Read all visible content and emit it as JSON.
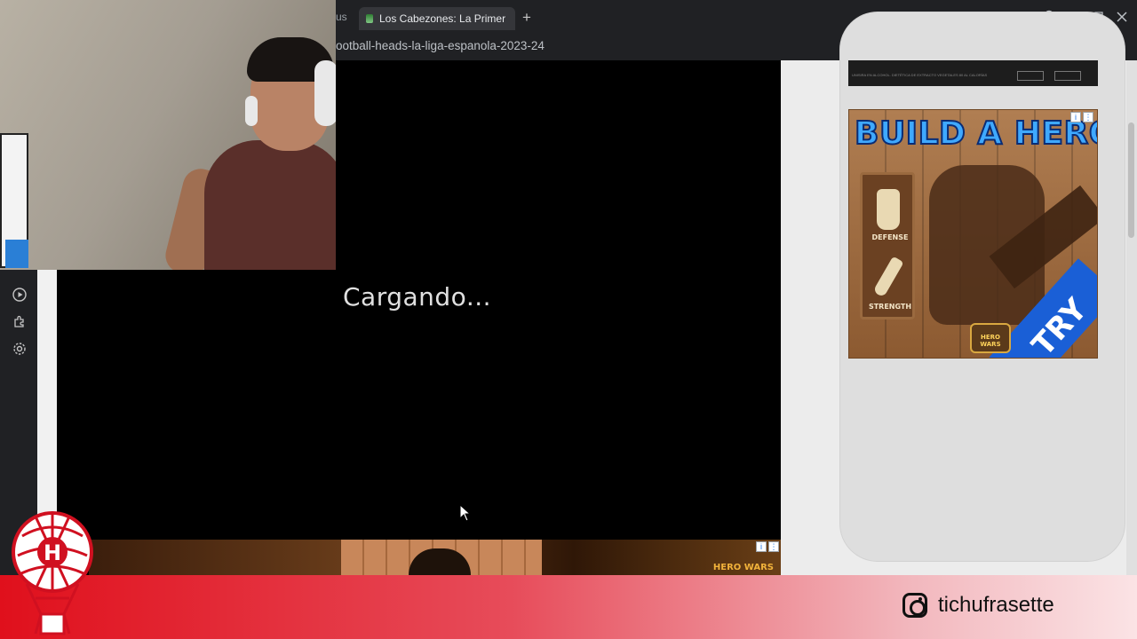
{
  "browser": {
    "prev_tab_fragment": "us",
    "active_tab_title": "Los Cabezones: La Primer",
    "new_tab_symbol": "+",
    "url": "ootball-heads-la-liga-espanola-2023-24",
    "window_controls": [
      "search-icon",
      "minimize-icon",
      "restore-icon",
      "close-icon"
    ]
  },
  "sidebar": {
    "icons": [
      "play-circle-icon",
      "puzzle-icon",
      "settings-icon"
    ]
  },
  "game": {
    "loading_text": "Cargando..."
  },
  "ads": {
    "hero": {
      "title": "BUILD A HERO!",
      "stat1": "DEFENSE",
      "stat2": "STRENGTH",
      "cta": "TRY",
      "brand": "HERO WARS"
    },
    "bottom_brand": "HERO WARS",
    "top_fine_print": "UNISIRA EN ALCOHOL. DIETÉTICA DE EXTRACTO VEGETALES 80 AL CALORÍAS"
  },
  "overlay": {
    "instagram_handle": "tichufrasette",
    "club_letter": "H"
  },
  "colors": {
    "footer_start": "#e0101c",
    "footer_end": "#fbe3e5",
    "tab_bg": "#35363a",
    "chrome_bg": "#202124"
  }
}
